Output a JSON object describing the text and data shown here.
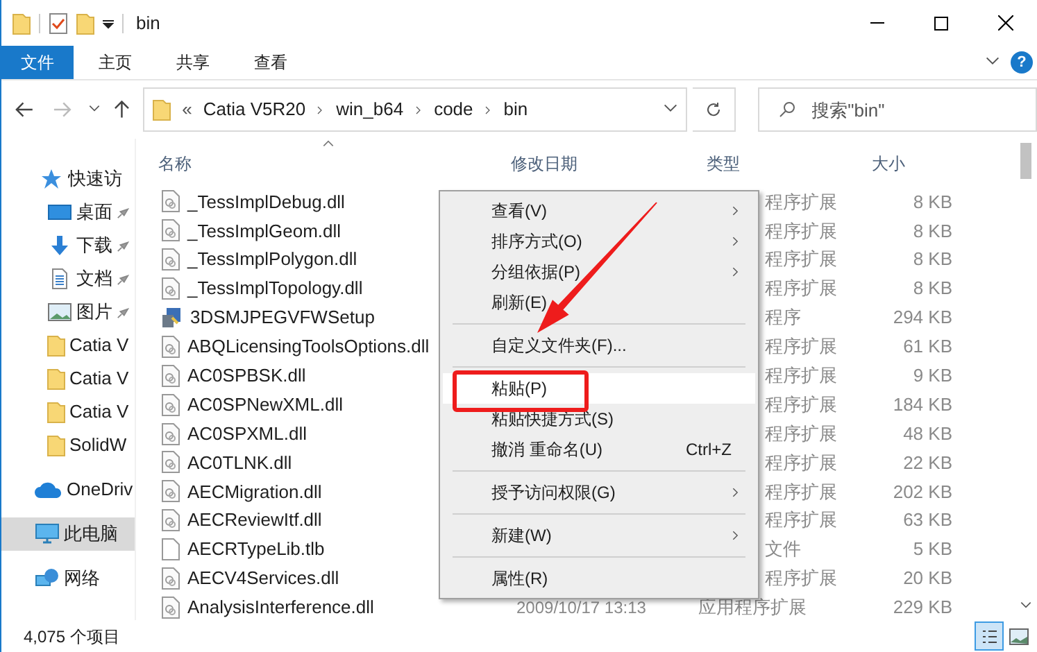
{
  "window": {
    "title": "bin"
  },
  "ribbon_tabs": [
    {
      "label": "文件",
      "selected": true
    },
    {
      "label": "主页",
      "selected": false
    },
    {
      "label": "共享",
      "selected": false
    },
    {
      "label": "查看",
      "selected": false
    }
  ],
  "address": {
    "overflow": "«",
    "path": [
      "Catia V5R20",
      "win_b64",
      "code",
      "bin"
    ]
  },
  "search": {
    "placeholder": "搜索\"bin\""
  },
  "help": "?",
  "sidebar": {
    "items": [
      {
        "label": "快速访",
        "kind": "star",
        "pinned": false,
        "selected": false
      },
      {
        "label": "桌面",
        "kind": "desktop",
        "pinned": true,
        "selected": false
      },
      {
        "label": "下载",
        "kind": "download",
        "pinned": true,
        "selected": false
      },
      {
        "label": "文档",
        "kind": "document",
        "pinned": true,
        "selected": false
      },
      {
        "label": "图片",
        "kind": "image",
        "pinned": true,
        "selected": false
      },
      {
        "label": "Catia V",
        "kind": "folder",
        "pinned": false,
        "selected": false
      },
      {
        "label": "Catia V",
        "kind": "folder",
        "pinned": false,
        "selected": false
      },
      {
        "label": "Catia V",
        "kind": "folder",
        "pinned": false,
        "selected": false
      },
      {
        "label": "SolidW",
        "kind": "folder",
        "pinned": false,
        "selected": false
      },
      {
        "label": "OneDriv",
        "kind": "cloud",
        "pinned": false,
        "selected": false
      },
      {
        "label": "此电脑",
        "kind": "computer",
        "pinned": false,
        "selected": true
      },
      {
        "label": "网络",
        "kind": "network",
        "pinned": false,
        "selected": false
      }
    ]
  },
  "table": {
    "columns": [
      "名称",
      "修改日期",
      "类型",
      "大小"
    ],
    "rows": [
      {
        "name": "_TessImplDebug.dll",
        "kind": "dll",
        "type": "程序扩展",
        "size": "8 KB"
      },
      {
        "name": "_TessImplGeom.dll",
        "kind": "dll",
        "type": "程序扩展",
        "size": "8 KB"
      },
      {
        "name": "_TessImplPolygon.dll",
        "kind": "dll",
        "type": "程序扩展",
        "size": "8 KB"
      },
      {
        "name": "_TessImplTopology.dll",
        "kind": "dll",
        "type": "程序扩展",
        "size": "8 KB"
      },
      {
        "name": "3DSMJPEGVFWSetup",
        "kind": "exe",
        "type": "程序",
        "size": "294 KB"
      },
      {
        "name": "ABQLicensingToolsOptions.dll",
        "kind": "dll",
        "type": "程序扩展",
        "size": "61 KB"
      },
      {
        "name": "AC0SPBSK.dll",
        "kind": "dll",
        "type": "程序扩展",
        "size": "9 KB"
      },
      {
        "name": "AC0SPNewXML.dll",
        "kind": "dll",
        "type": "程序扩展",
        "size": "184 KB"
      },
      {
        "name": "AC0SPXML.dll",
        "kind": "dll",
        "type": "程序扩展",
        "size": "48 KB"
      },
      {
        "name": "AC0TLNK.dll",
        "kind": "dll",
        "type": "程序扩展",
        "size": "22 KB"
      },
      {
        "name": "AECMigration.dll",
        "kind": "dll",
        "type": "程序扩展",
        "size": "202 KB"
      },
      {
        "name": "AECReviewItf.dll",
        "kind": "dll",
        "type": "程序扩展",
        "size": "63 KB"
      },
      {
        "name": "AECRTypeLib.tlb",
        "kind": "file",
        "type": "文件",
        "size": "5 KB"
      },
      {
        "name": "AECV4Services.dll",
        "kind": "dll",
        "type": "程序扩展",
        "size": "20 KB"
      },
      {
        "name": "AnalysisInterference.dll",
        "kind": "dll",
        "date": "2009/10/17 13:13",
        "type": "应用程序扩展",
        "size": "229 KB"
      }
    ]
  },
  "context_menu": {
    "items": [
      {
        "kind": "item",
        "label": "查看(V)",
        "submenu": true,
        "selected": false
      },
      {
        "kind": "item",
        "label": "排序方式(O)",
        "submenu": true,
        "selected": false
      },
      {
        "kind": "item",
        "label": "分组依据(P)",
        "submenu": true,
        "selected": false
      },
      {
        "kind": "item",
        "label": "刷新(E)",
        "submenu": false,
        "selected": false
      },
      {
        "kind": "separator"
      },
      {
        "kind": "item",
        "label": "自定义文件夹(F)...",
        "submenu": false,
        "selected": false
      },
      {
        "kind": "separator"
      },
      {
        "kind": "item",
        "label": "粘贴(P)",
        "submenu": false,
        "selected": true
      },
      {
        "kind": "item",
        "label": "粘贴快捷方式(S)",
        "submenu": false,
        "selected": false
      },
      {
        "kind": "item",
        "label": "撤消 重命名(U)",
        "shortcut": "Ctrl+Z",
        "submenu": false,
        "selected": false
      },
      {
        "kind": "separator"
      },
      {
        "kind": "item",
        "label": "授予访问权限(G)",
        "submenu": true,
        "selected": false
      },
      {
        "kind": "separator"
      },
      {
        "kind": "item",
        "label": "新建(W)",
        "submenu": true,
        "selected": false
      },
      {
        "kind": "separator"
      },
      {
        "kind": "item",
        "label": "属性(R)",
        "submenu": false,
        "selected": false
      }
    ]
  },
  "status_bar": {
    "count": "4,075 个项目"
  }
}
